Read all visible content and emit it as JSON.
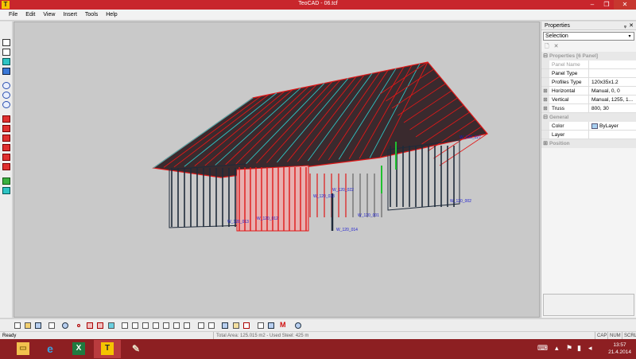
{
  "window": {
    "app_icon_letter": "T",
    "title": "TeoCAD - 06.tcf",
    "minimize_glyph": "–",
    "maximize_glyph": "❐",
    "close_glyph": "✕"
  },
  "menu": {
    "items": [
      "File",
      "Edit",
      "View",
      "Insert",
      "Tools",
      "Help"
    ]
  },
  "viewport": {
    "labels": [
      "W_120_027",
      "W_120_022",
      "W_120_033",
      "W_120_001",
      "W_120_013",
      "W_120_012",
      "W_120_014",
      "W_120_002"
    ]
  },
  "properties": {
    "title": "Properties",
    "pin_glyph": "ᵩ",
    "close_glyph": "✕",
    "selection": "Selection",
    "dropdown_arrow": "▾",
    "new_glyph": "🗋",
    "delete_glyph": "✕",
    "section_main": "Properties [6 Panel]",
    "rows_main": [
      {
        "expander": "",
        "name": "Panel Name",
        "value": "",
        "dim": true
      },
      {
        "expander": "",
        "name": "Panel Type",
        "value": "",
        "dim": false
      },
      {
        "expander": "",
        "name": "Profiles Type",
        "value": "120x35x1.2",
        "dim": false
      },
      {
        "expander": "⊞",
        "name": "Horizontal",
        "value": "Manual, 0, 0",
        "dim": false
      },
      {
        "expander": "⊞",
        "name": "Vertical",
        "value": "Manual, 1255, 1...",
        "dim": false
      },
      {
        "expander": "⊞",
        "name": "Truss",
        "value": "800, 30",
        "dim": false
      }
    ],
    "section_general": "General",
    "rows_general": [
      {
        "name": "Color",
        "value": "ByLayer",
        "swatch": "#a8d0f0"
      },
      {
        "name": "Layer",
        "value": ""
      }
    ],
    "section_position": "Position",
    "section_expander_open": "⊟",
    "section_expander_closed": "⊞"
  },
  "statusbar": {
    "ready": "Ready",
    "info": "Total Area: 125.015 m2  -  Used Steel: 425 m",
    "cap": "CAP",
    "num": "NUM",
    "scrl": "SCRL"
  },
  "taskbar": {
    "apps": [
      {
        "name": "file-explorer",
        "glyph": "▭",
        "color": "#f2c14e",
        "active": false
      },
      {
        "name": "internet-explorer",
        "glyph": "e",
        "color": "#3aa3e3",
        "active": false
      },
      {
        "name": "excel",
        "glyph": "X",
        "color": "#1f7a3f",
        "active": false
      },
      {
        "name": "teocad",
        "glyph": "T",
        "color": "#f5c400",
        "active": true
      },
      {
        "name": "paint",
        "glyph": "✎",
        "color": "#e8e0c8",
        "active": false
      }
    ],
    "time": "13:57",
    "date": "21.4.2014"
  },
  "colors": {
    "titlebar": "#c8262c",
    "taskbar": "#8d1f22",
    "model_red": "#e01818",
    "model_dark": "#1e2a3a",
    "model_cyan": "#2ec4c4",
    "label_blue": "#1c1cd0"
  }
}
